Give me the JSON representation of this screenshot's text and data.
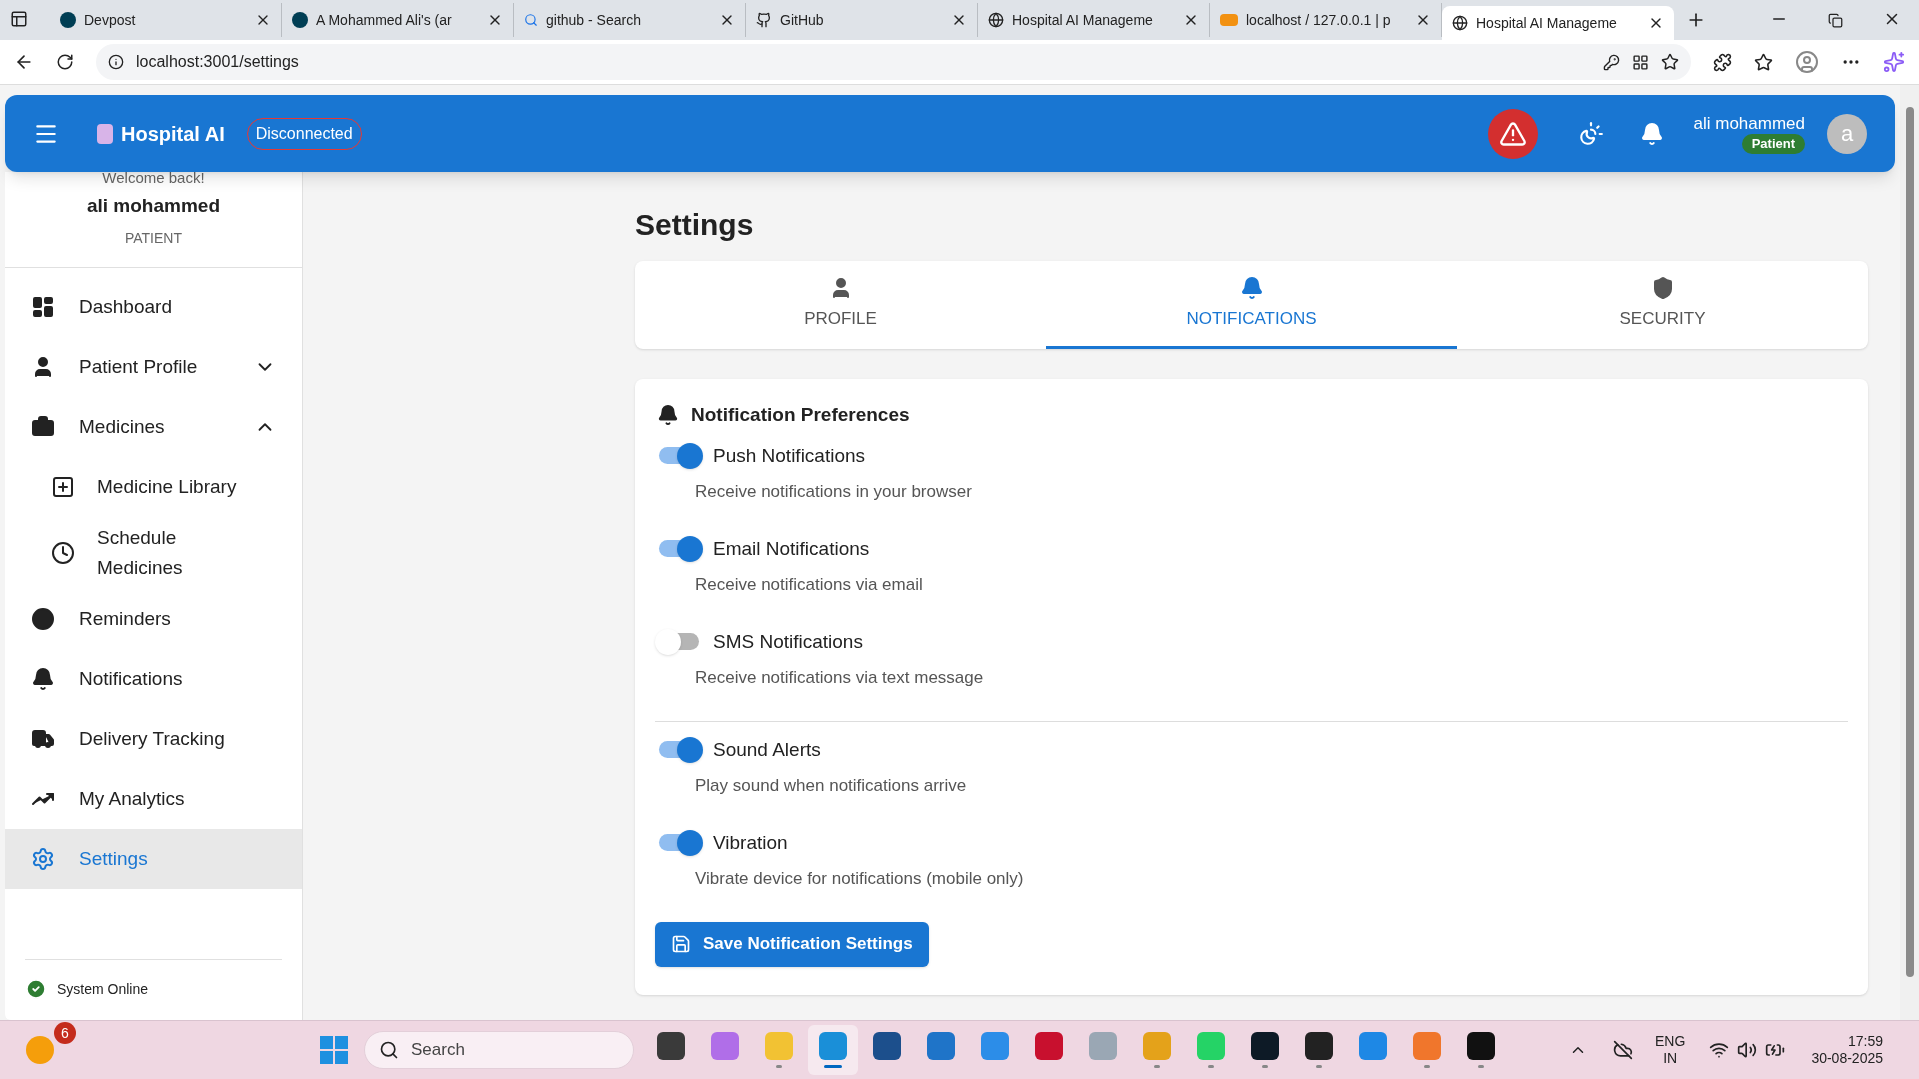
{
  "browser": {
    "tabs": [
      {
        "title": "Devpost",
        "selected": false
      },
      {
        "title": "A Mohammed Ali's (ar",
        "selected": false
      },
      {
        "title": "github - Search",
        "selected": false
      },
      {
        "title": "GitHub",
        "selected": false
      },
      {
        "title": "Hospital AI Manageme",
        "selected": false
      },
      {
        "title": "localhost / 127.0.0.1 | p",
        "selected": false
      },
      {
        "title": "Hospital AI Manageme",
        "selected": true
      }
    ],
    "address": "localhost:3001/settings"
  },
  "header": {
    "brand": "Hospital AI",
    "connection": "Disconnected",
    "user_name": "ali mohammed",
    "role": "Patient",
    "avatar": "a"
  },
  "sidebar": {
    "greeting": "Welcome back!",
    "user_name": "ali mohammed",
    "role": "PATIENT",
    "items": [
      {
        "label": "Dashboard",
        "selected": false
      },
      {
        "label": "Patient Profile",
        "selected": false,
        "expanded": false
      },
      {
        "label": "Medicines",
        "selected": false,
        "expanded": true,
        "children": [
          {
            "label": "Medicine Library",
            "selected": false
          },
          {
            "label": "Schedule Medicines",
            "selected": false
          }
        ]
      },
      {
        "label": "Reminders",
        "selected": false
      },
      {
        "label": "Notifications",
        "selected": false
      },
      {
        "label": "Delivery Tracking",
        "selected": false
      },
      {
        "label": "My Analytics",
        "selected": false
      },
      {
        "label": "Settings",
        "selected": true
      }
    ],
    "status": "System Online"
  },
  "page": {
    "title": "Settings",
    "tabs": [
      {
        "label": "PROFILE",
        "selected": false
      },
      {
        "label": "NOTIFICATIONS",
        "selected": true
      },
      {
        "label": "SECURITY",
        "selected": false
      }
    ],
    "section_title": "Notification Preferences",
    "groups": [
      [
        {
          "label": "Push Notifications",
          "description": "Receive notifications in your browser",
          "on": true
        },
        {
          "label": "Email Notifications",
          "description": "Receive notifications via email",
          "on": true
        },
        {
          "label": "SMS Notifications",
          "description": "Receive notifications via text message",
          "on": false
        }
      ],
      [
        {
          "label": "Sound Alerts",
          "description": "Play sound when notifications arrive",
          "on": true
        },
        {
          "label": "Vibration",
          "description": "Vibrate device for notifications (mobile only)",
          "on": true
        }
      ]
    ],
    "save_button": "Save Notification Settings"
  },
  "taskbar": {
    "weather_badge": "6",
    "search_placeholder": "Search",
    "apps": [
      {
        "selected": false,
        "running": false
      },
      {
        "selected": false,
        "running": false
      },
      {
        "selected": false,
        "running": true
      },
      {
        "selected": true,
        "running": true
      },
      {
        "selected": false,
        "running": false
      },
      {
        "selected": false,
        "running": false
      },
      {
        "selected": false,
        "running": false
      },
      {
        "selected": false,
        "running": false
      },
      {
        "selected": false,
        "running": false
      },
      {
        "selected": false,
        "running": true
      },
      {
        "selected": false,
        "running": true
      },
      {
        "selected": false,
        "running": true
      },
      {
        "selected": false,
        "running": true
      },
      {
        "selected": false,
        "running": false
      },
      {
        "selected": false,
        "running": true
      },
      {
        "selected": false,
        "running": true
      }
    ],
    "language": "ENG",
    "region": "IN",
    "time": "17:59",
    "date": "30-08-2025"
  }
}
